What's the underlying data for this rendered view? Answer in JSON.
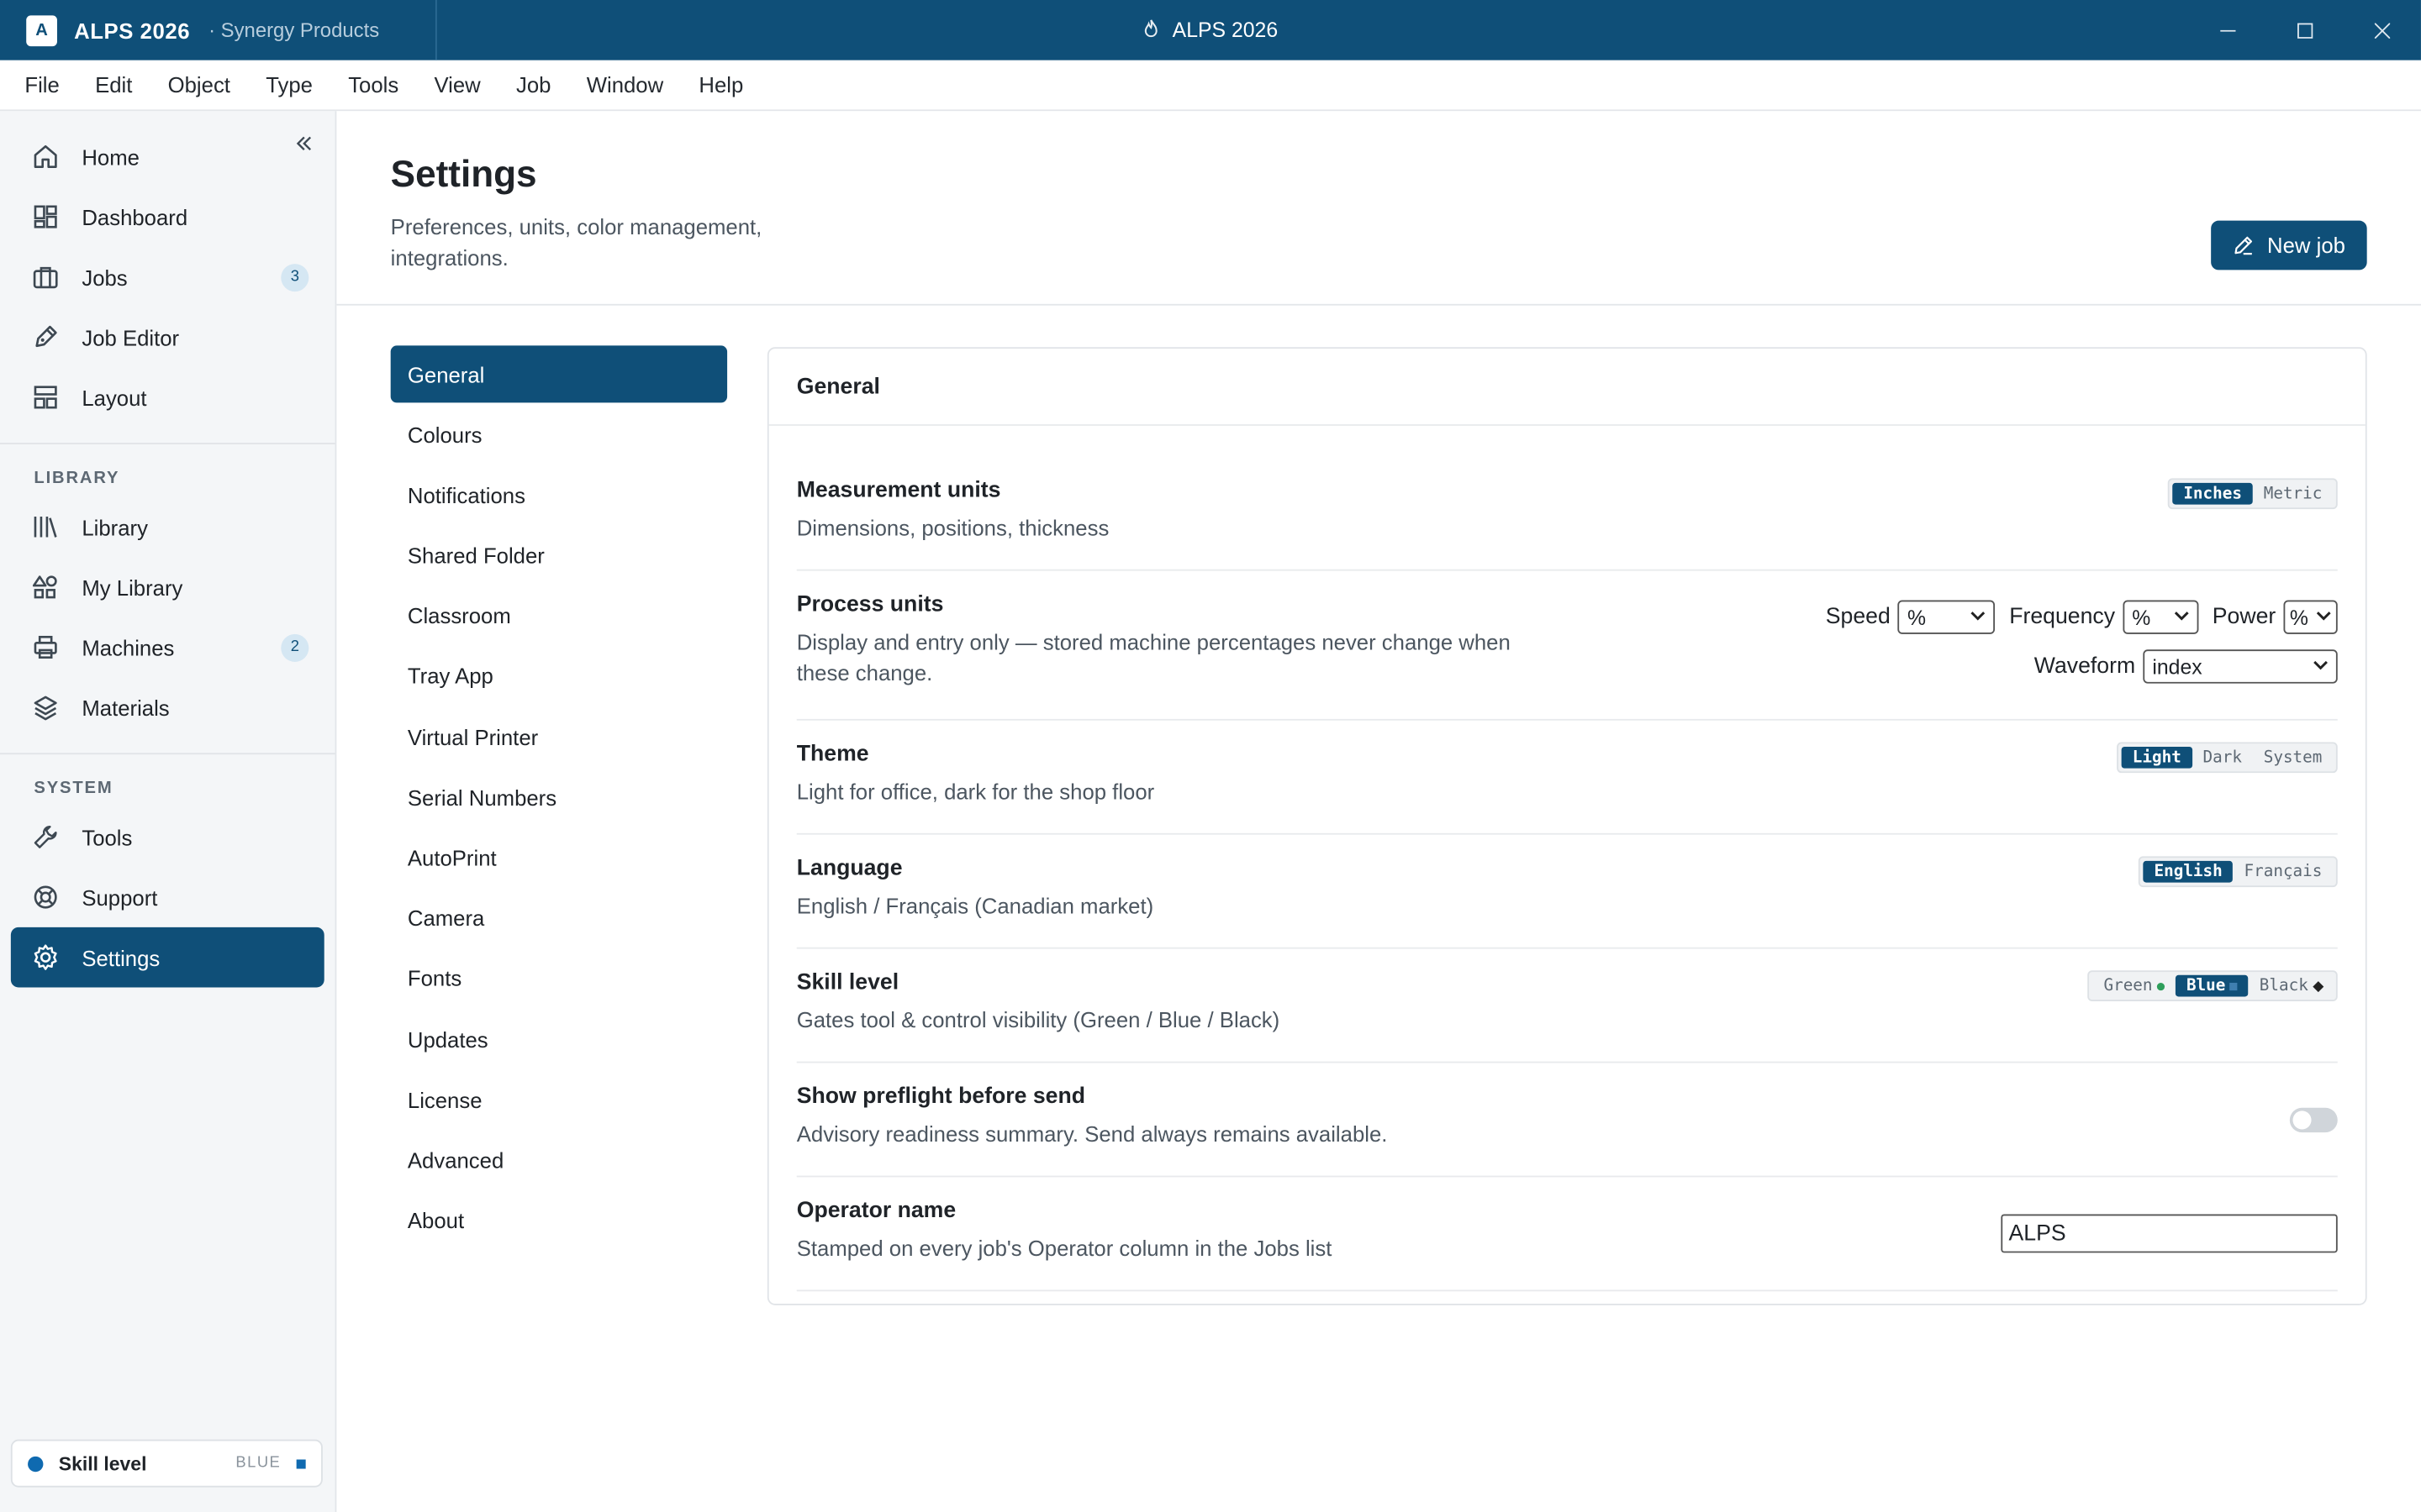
{
  "titlebar": {
    "app_logo_letter": "A",
    "app_name": "ALPS 2026",
    "org": "· Synergy Products",
    "window_title": "ALPS 2026"
  },
  "menu": [
    "File",
    "Edit",
    "Object",
    "Type",
    "Tools",
    "View",
    "Job",
    "Window",
    "Help"
  ],
  "sidebar": {
    "main_items": [
      {
        "label": "Home",
        "icon": "home-icon"
      },
      {
        "label": "Dashboard",
        "icon": "dashboard-icon"
      },
      {
        "label": "Jobs",
        "icon": "briefcase-icon",
        "badge": "3"
      },
      {
        "label": "Job Editor",
        "icon": "pen-icon"
      },
      {
        "label": "Layout",
        "icon": "layout-icon"
      }
    ],
    "library_label": "LIBRARY",
    "library_items": [
      {
        "label": "Library",
        "icon": "library-icon"
      },
      {
        "label": "My Library",
        "icon": "shapes-icon"
      },
      {
        "label": "Machines",
        "icon": "printer-icon",
        "badge": "2"
      },
      {
        "label": "Materials",
        "icon": "layers-icon"
      }
    ],
    "system_label": "SYSTEM",
    "system_items": [
      {
        "label": "Tools",
        "icon": "wrench-icon"
      },
      {
        "label": "Support",
        "icon": "lifebuoy-icon"
      },
      {
        "label": "Settings",
        "icon": "gear-icon",
        "active": true
      }
    ],
    "skill_footer": {
      "label": "Skill level",
      "level": "BLUE",
      "color": "#0f6ab0"
    }
  },
  "page": {
    "title": "Settings",
    "subtitle": "Preferences, units, color management, integrations.",
    "new_job_label": "New job"
  },
  "settings_nav": [
    "General",
    "Colours",
    "Notifications",
    "Shared Folder",
    "Classroom",
    "Tray App",
    "Virtual Printer",
    "Serial Numbers",
    "AutoPrint",
    "Camera",
    "Fonts",
    "Updates",
    "License",
    "Advanced",
    "About"
  ],
  "panel": {
    "title": "General",
    "measurement": {
      "title": "Measurement units",
      "desc": "Dimensions, positions, thickness",
      "options": [
        "Inches",
        "Metric"
      ],
      "selected": "Inches"
    },
    "process": {
      "title": "Process units",
      "desc": "Display and entry only — stored machine percentages never change when these change.",
      "speed_label": "Speed",
      "speed_value": "%",
      "frequency_label": "Frequency",
      "frequency_value": "%",
      "power_label": "Power",
      "power_value": "%",
      "waveform_label": "Waveform",
      "waveform_value": "index"
    },
    "theme": {
      "title": "Theme",
      "desc": "Light for office, dark for the shop floor",
      "options": [
        "Light",
        "Dark",
        "System"
      ],
      "selected": "Light"
    },
    "language": {
      "title": "Language",
      "desc": "English / Français (Canadian market)",
      "options": [
        "English",
        "Français"
      ],
      "selected": "English"
    },
    "skill": {
      "title": "Skill level",
      "desc": "Gates tool & control visibility (Green / Blue / Black)",
      "options": [
        "Green",
        "Blue",
        "Black"
      ],
      "selected": "Blue",
      "colors": {
        "green": "#2e9e5b",
        "blue": "#0f6ab0",
        "black": "#222222"
      }
    },
    "preflight": {
      "title": "Show preflight before send",
      "desc": "Advisory readiness summary. Send always remains available.",
      "enabled": false
    },
    "operator": {
      "title": "Operator name",
      "desc": "Stamped on every job's Operator column in the Jobs list",
      "value": "ALPS"
    }
  },
  "colors": {
    "brand": "#0f4f78",
    "badge_bg": "#d5e7f3"
  }
}
